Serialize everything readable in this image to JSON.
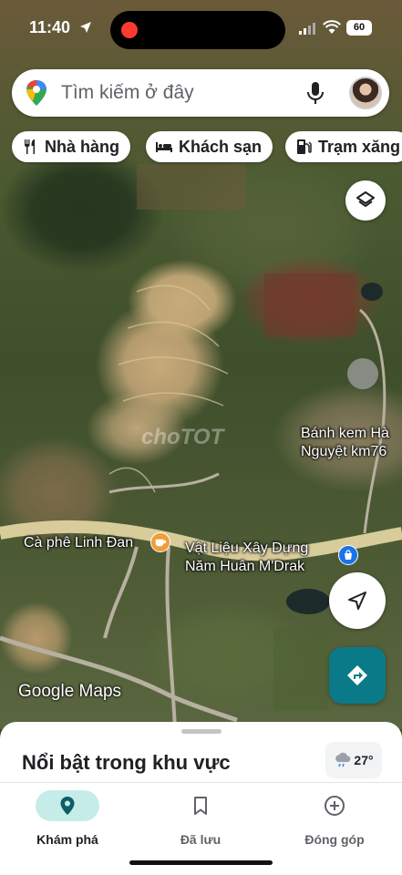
{
  "status_bar": {
    "time": "11:40",
    "battery": "60"
  },
  "search": {
    "placeholder": "Tìm kiếm ở đây",
    "icons": [
      "google-maps-pin-icon",
      "mic-icon",
      "avatar"
    ]
  },
  "chips": [
    {
      "label": "Nhà hàng",
      "icon": "fork-knife-icon"
    },
    {
      "label": "Khách sạn",
      "icon": "bed-icon"
    },
    {
      "label": "Trạm xăng",
      "icon": "gas-pump-icon"
    }
  ],
  "map": {
    "labels": {
      "bakery_line1": "Bánh kem Hà",
      "bakery_line2": "Nguyệt km76",
      "cafe": "Cà phê Linh Đan",
      "store_line1": "Vật Liệu Xây Dựng",
      "store_line2": "Năm Huân M'Drak"
    },
    "watermark": "choTOT",
    "google_logo": "Google Maps"
  },
  "sheet": {
    "title": "Nổi bật trong khu vực",
    "weather": "27°"
  },
  "nav": [
    {
      "label": "Khám phá",
      "icon": "explore-pin-icon",
      "active": true
    },
    {
      "label": "Đã lưu",
      "icon": "bookmark-icon",
      "active": false
    },
    {
      "label": "Đóng góp",
      "icon": "add-circle-icon",
      "active": false
    }
  ],
  "colors": {
    "accent": "#0b7a88",
    "active_nav_pill": "#c6ece9",
    "recording_dot": "#ff3b30",
    "cafe_poi": "#f29d38",
    "store_poi": "#1a73e8"
  }
}
